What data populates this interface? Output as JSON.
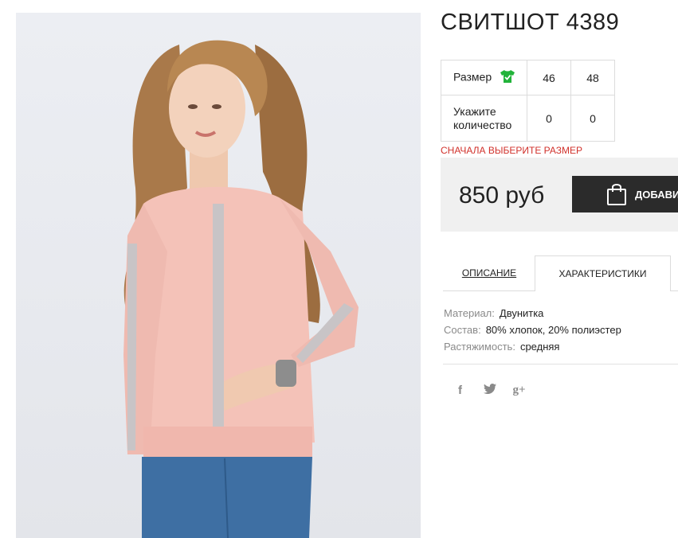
{
  "product": {
    "title": "СВИТШОТ 4389"
  },
  "sizes": {
    "size_label": "Размер",
    "qty_label": "Укажите количество",
    "columns": [
      {
        "size": "46",
        "qty": "0"
      },
      {
        "size": "48",
        "qty": "0"
      }
    ]
  },
  "warning": "СНАЧАЛА ВЫБЕРИТЕ РАЗМЕР",
  "price": "850 руб",
  "buy_button": "ДОБАВИТЬ В КОРЗИНУ",
  "tabs": [
    {
      "label": "ОПИСАНИЕ",
      "active": false
    },
    {
      "label": "ХАРАКТЕРИСТИКИ",
      "active": true
    }
  ],
  "specs": [
    {
      "key": "Материал:",
      "value": "Двунитка"
    },
    {
      "key": "Состав:",
      "value": "80% хлопок, 20% полиэстер"
    },
    {
      "key": "Растяжимость:",
      "value": "средняя"
    }
  ],
  "social": [
    {
      "icon": "facebook-icon",
      "glyph": "f"
    },
    {
      "icon": "twitter-icon",
      "glyph": "t"
    },
    {
      "icon": "google-plus-icon",
      "glyph": "g+"
    }
  ],
  "colors": {
    "warning": "#d1312b",
    "button": "#2b2b2b",
    "price_bg": "#f0f0f0",
    "shirt_icon": "#22b33a",
    "sweatshirt": "#f2c0b8"
  }
}
